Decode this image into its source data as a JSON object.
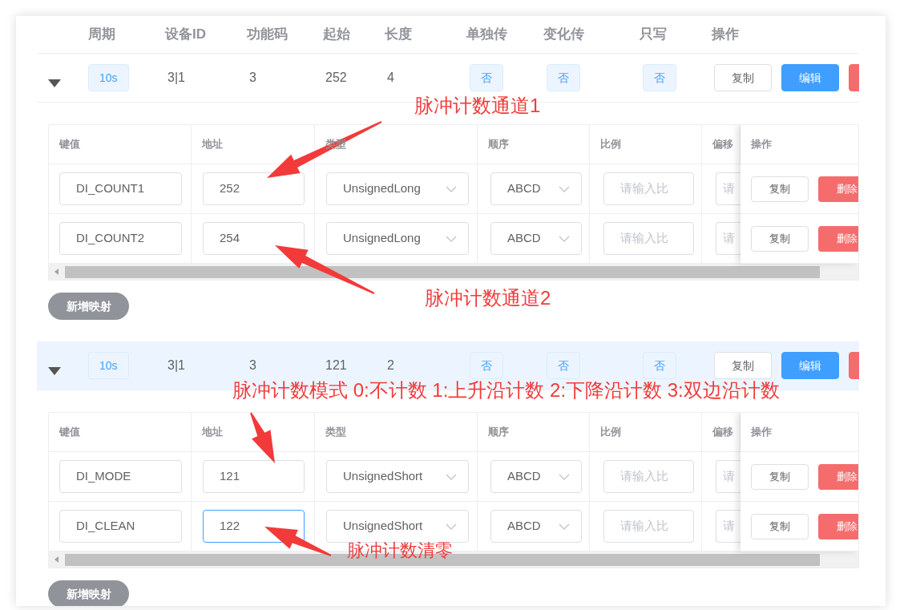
{
  "columns": [
    "周期",
    "设备ID",
    "功能码",
    "起始",
    "长度",
    "单独传",
    "变化传",
    "只写",
    "操作"
  ],
  "groups": [
    {
      "expanded": true,
      "highlighted": false,
      "cells": {
        "period": "10s",
        "device_id": "3|1",
        "function_code": "3",
        "start": "252",
        "length": "4",
        "single": "否",
        "change": "否",
        "write_only": "否"
      },
      "actions": [
        {
          "kind": "default",
          "label": "复制"
        },
        {
          "kind": "primary",
          "label": "编辑"
        },
        {
          "kind": "danger"
        }
      ],
      "mapping": {
        "columns": [
          "键值",
          "地址",
          "类型",
          "顺序",
          "比例",
          "偏移",
          "操作"
        ],
        "rows": [
          {
            "key": "DI_COUNT1",
            "address": "252",
            "address_focused": false,
            "type": "UnsignedLong",
            "order": "ABCD",
            "ratio_placeholder": "请输入比",
            "offset_placeholder": "请",
            "actions": [
              "复制",
              "删除"
            ]
          },
          {
            "key": "DI_COUNT2",
            "address": "254",
            "address_focused": false,
            "type": "UnsignedLong",
            "order": "ABCD",
            "ratio_placeholder": "请输入比",
            "offset_placeholder": "请",
            "actions": [
              "复制",
              "删除"
            ]
          }
        ],
        "add_button": "新增映射"
      }
    },
    {
      "expanded": true,
      "highlighted": true,
      "cells": {
        "period": "10s",
        "device_id": "3|1",
        "function_code": "3",
        "start": "121",
        "length": "2",
        "single": "否",
        "change": "否",
        "write_only": "否"
      },
      "actions": [
        {
          "kind": "default",
          "label": "复制"
        },
        {
          "kind": "primary",
          "label": "编辑"
        },
        {
          "kind": "danger"
        }
      ],
      "mapping": {
        "columns": [
          "键值",
          "地址",
          "类型",
          "顺序",
          "比例",
          "偏移",
          "操作"
        ],
        "rows": [
          {
            "key": "DI_MODE",
            "address": "121",
            "address_focused": false,
            "type": "UnsignedShort",
            "order": "ABCD",
            "ratio_placeholder": "请输入比",
            "offset_placeholder": "请",
            "actions": [
              "复制",
              "删除"
            ]
          },
          {
            "key": "DI_CLEAN",
            "address": "122",
            "address_focused": true,
            "type": "UnsignedShort",
            "order": "ABCD",
            "ratio_placeholder": "请输入比",
            "offset_placeholder": "请",
            "actions": [
              "复制",
              "删除"
            ]
          }
        ],
        "add_button": "新增映射"
      }
    }
  ],
  "annotations": [
    "脉冲计数通道1",
    "脉冲计数通道2",
    "脉冲计数模式 0:不计数 1:上升沿计数 2:下降沿计数 3:双边沿计数",
    "脉冲计数清零"
  ]
}
